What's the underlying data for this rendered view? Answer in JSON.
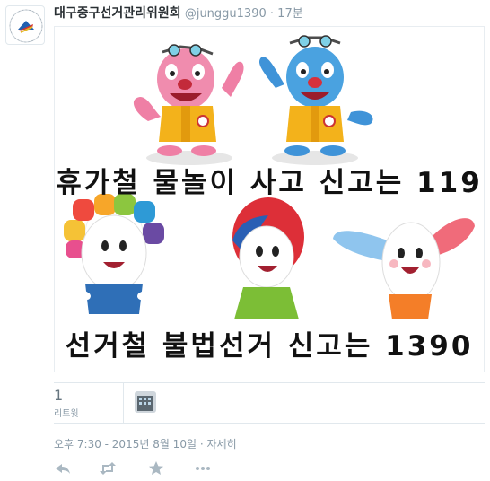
{
  "tweet": {
    "display_name": "대구중구선거관리위원회",
    "handle": "@junggu1390",
    "separator": "·",
    "relative_time": "17분"
  },
  "image": {
    "caption_line1": "휴가철 물놀이 사고 신고는 119",
    "caption_line2": "선거철 불법선거 신고는 1390"
  },
  "stats": {
    "retweet_count": "1",
    "retweet_label": "리트윗"
  },
  "meta": {
    "timestamp": "오후 7:30 - 2015년 8월 10일",
    "separator": "·",
    "details_link": "자세히"
  },
  "actions": [
    {
      "icon": "reply-icon"
    },
    {
      "icon": "retweet-icon"
    },
    {
      "icon": "favorite-star-icon"
    },
    {
      "icon": "more-icon"
    }
  ],
  "colors": {
    "text": "#292f33",
    "muted": "#8899a6",
    "border": "#e1e8ed",
    "action_icon": "#aab8c2"
  }
}
